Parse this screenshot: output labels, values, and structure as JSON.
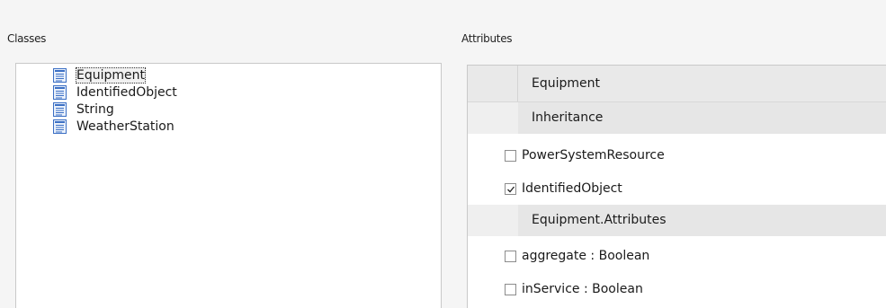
{
  "classes_label": "Classes",
  "attributes_label": "Attributes",
  "classes": [
    {
      "name": "Equipment",
      "selected": true,
      "icon": "class-icon"
    },
    {
      "name": "IdentifiedObject",
      "selected": false,
      "icon": "class-icon"
    },
    {
      "name": "String",
      "selected": false,
      "icon": "class-icon"
    },
    {
      "name": "WeatherStation",
      "selected": false,
      "icon": "class-icon"
    }
  ],
  "attributes": {
    "header": "Equipment",
    "inheritance_group": "Inheritance",
    "inheritance_items": [
      {
        "label": "PowerSystemResource",
        "checked": false
      },
      {
        "label": "IdentifiedObject",
        "checked": true
      }
    ],
    "attributes_group": "Equipment.Attributes",
    "attribute_items": [
      {
        "label": "aggregate : Boolean",
        "checked": false
      },
      {
        "label": "inService : Boolean",
        "checked": false
      }
    ]
  },
  "colors": {
    "window_bg": "#f5f5f5",
    "panel_bg": "#ffffff",
    "header_bg": "#e9e9e9",
    "group_bg": "#e6e6e6",
    "icon_blue": "#3b6fc4"
  }
}
